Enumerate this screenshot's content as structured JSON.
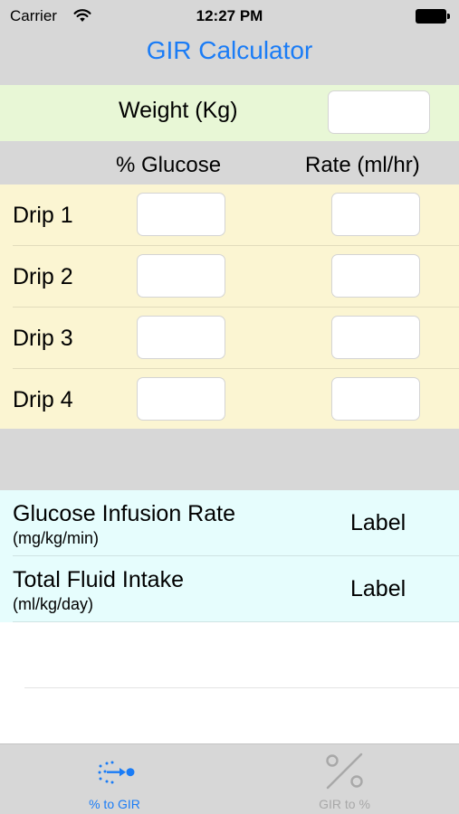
{
  "status_bar": {
    "carrier": "Carrier",
    "time": "12:27 PM"
  },
  "nav": {
    "title": "GIR Calculator"
  },
  "weight": {
    "label": "Weight (Kg)",
    "value": ""
  },
  "columns": {
    "glucose": "% Glucose",
    "rate": "Rate (ml/hr)"
  },
  "drips": [
    {
      "label": "Drip 1",
      "glucose": "",
      "rate": ""
    },
    {
      "label": "Drip 2",
      "glucose": "",
      "rate": ""
    },
    {
      "label": "Drip 3",
      "glucose": "",
      "rate": ""
    },
    {
      "label": "Drip 4",
      "glucose": "",
      "rate": ""
    }
  ],
  "results": [
    {
      "title": "Glucose Infusion Rate",
      "unit": "(mg/kg/min)",
      "value": "Label"
    },
    {
      "title": "Total Fluid Intake",
      "unit": "(ml/kg/day)",
      "value": "Label"
    }
  ],
  "tabs": [
    {
      "label": "% to GIR",
      "icon": "percent-to-gir-icon",
      "active": true
    },
    {
      "label": "GIR to %",
      "icon": "percent-icon",
      "active": false
    }
  ],
  "colors": {
    "accent": "#1a7cf6",
    "nav_bg": "#d7d7d7",
    "weight_bg": "#e8f7d6",
    "drips_bg": "#fbf5d2",
    "results_bg": "#e6fdfd",
    "inactive_tab": "#a8a8a8"
  }
}
